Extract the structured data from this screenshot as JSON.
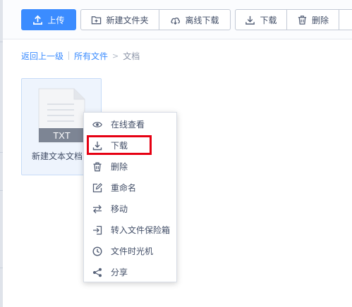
{
  "toolbar": {
    "upload": "上传",
    "new_folder": "新建文件夹",
    "offline_download": "离线下载",
    "download": "下载",
    "delete": "删除"
  },
  "breadcrumb": {
    "back": "返回上一级",
    "all_files": "所有文件",
    "arrow": ">",
    "current": "文档"
  },
  "file": {
    "type_label": "TXT",
    "name": "新建文本文档"
  },
  "context_menu": {
    "items": [
      {
        "label": "在线查看",
        "icon": "eye-icon"
      },
      {
        "label": "下载",
        "icon": "download-icon"
      },
      {
        "label": "删除",
        "icon": "trash-icon"
      },
      {
        "label": "重命名",
        "icon": "rename-icon"
      },
      {
        "label": "移动",
        "icon": "move-icon"
      },
      {
        "label": "转入文件保险箱",
        "icon": "safe-box-icon"
      },
      {
        "label": "文件时光机",
        "icon": "clock-icon"
      },
      {
        "label": "分享",
        "icon": "share-icon"
      }
    ]
  },
  "colors": {
    "accent": "#3b8cff",
    "highlight": "#e60012",
    "text": "#424e67",
    "icon": "#566178"
  }
}
